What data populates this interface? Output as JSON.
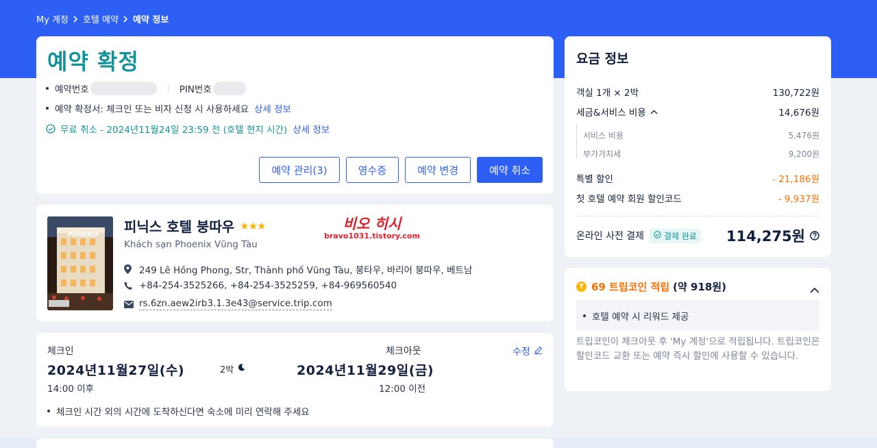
{
  "breadcrumb": {
    "items": [
      "My 계정",
      "호텔 예약",
      "예약 정보"
    ]
  },
  "status": {
    "title": "예약 확정",
    "booking_no_label": "예약번호",
    "pin_label": "PIN번호",
    "confirmation_text": "예약 확정서: 체크인 또는 비자 신청 시 사용하세요",
    "confirmation_link": "상세 정보",
    "free_cancel_text": "무료 취소 - 2024년11월24일 23:59 전 (호텔 현지 시간)",
    "free_cancel_link": "상세 정보",
    "buttons": {
      "manage": "예약 관리(3)",
      "receipt": "영수증",
      "modify": "예약 변경",
      "cancel": "예약 취소"
    }
  },
  "hotel": {
    "name": "피닉스 호텔 붕따우",
    "stars": "★★★",
    "local_name": "Khách sạn Phoenix Vũng Tàu",
    "address": "249 Lê Hồng Phong, Str, Thành phố Vũng Tàu, 붕타우, 바리어 붕따우, 베트남",
    "phone": "+84-254-3525266, +84-254-3525259, +84-969560540",
    "email": "rs.6zn.aew2irb3.1.3e43@service.trip.com",
    "photo_sign": "PHOENIX",
    "watermark_big": "비오 히시",
    "watermark_small": "bravo1031.tistory.com"
  },
  "checkin": {
    "checkin_label": "체크인",
    "checkin_date": "2024년11월27일(수)",
    "checkin_time": "14:00 이후",
    "nights": "2박",
    "checkout_label": "체크아웃",
    "checkout_date": "2024년11월29일(금)",
    "checkout_time": "12:00 이전",
    "edit_label": "수정",
    "note": "체크인 시간 외의 시간에 도착하신다면 숙소에 미리 연락해 주세요"
  },
  "price": {
    "title": "요금 정보",
    "room_label": "객실 1개 × 2박",
    "room_value": "130,722원",
    "tax_label": "세금&서비스 비용",
    "tax_value": "14,676원",
    "service_label": "서비스 비용",
    "service_value": "5,476원",
    "vat_label": "부가가치세",
    "vat_value": "9,200원",
    "special_label": "특별 할인",
    "special_value": "- 21,186원",
    "first_label": "첫 호텔 예약 회원 할인코드",
    "first_value": "- 9,937원",
    "total_label": "온라인 사전 결제",
    "paid_badge": "결제 완료",
    "total_value": "114,275원"
  },
  "coins": {
    "title_highlight": "69 트립코인 적립",
    "title_extra": "(약 918원)",
    "coin_icon_letter": "T",
    "reward_item": "호텔 예약 시 리워드 제공",
    "note": "트립코인이 체크아웃 후 'My 계정'으로 적립됩니다. 트립코인은 할인코드 교환 또는 예약 즉시 할인에 사용할 수 있습니다."
  },
  "colors": {
    "brand": "#2d5ff5",
    "teal": "#12939b",
    "orange": "#ff6f00",
    "star": "#f7b500"
  }
}
